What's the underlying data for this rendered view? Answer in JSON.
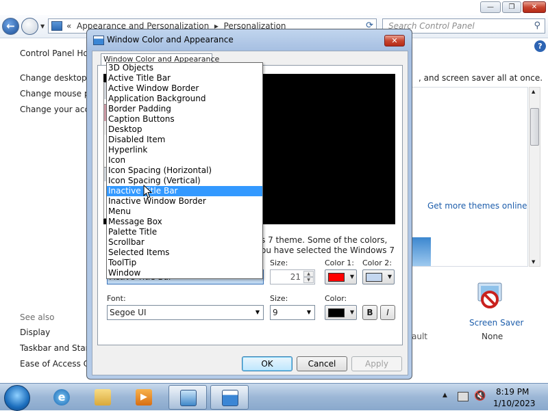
{
  "control_panel": {
    "breadcrumb": [
      "«",
      "Appearance and Personalization",
      "▸",
      "Personalization"
    ],
    "search_placeholder": "Search Control Panel",
    "sidebar": {
      "home": "Control Panel Hom",
      "links": [
        "Change desktop ic",
        "Change mouse po",
        "Change your acco"
      ],
      "see_also_heading": "See also",
      "see_also": [
        "Display",
        "Taskbar and Start M",
        "Ease of Access Cen"
      ]
    },
    "main_text": ", and screen saver all at once.",
    "get_more_themes": "Get more themes online",
    "screen_saver_label": "Screen Saver",
    "screen_saver_value": "None",
    "partial_text": "ault"
  },
  "dialog": {
    "title": "Window Color and Appearance",
    "tab": "Window Color and Appearance",
    "description_lines": [
      "s 7 theme.  Some of the colors,",
      "ou have selected the Windows 7"
    ],
    "size_label": "Size:",
    "size_value": "21",
    "color1_label": "Color 1:",
    "color2_label": "Color 2:",
    "item_value": "Active Title Bar",
    "font_label": "Font:",
    "font_value": "Segoe UI",
    "font_size_label": "Size:",
    "font_size_value": "9",
    "font_color_label": "Color:",
    "bold_label": "B",
    "italic_label": "I",
    "ok_label": "OK",
    "cancel_label": "Cancel",
    "apply_label": "Apply",
    "colors": {
      "color1": "#ff0000",
      "color2": "#c4d7f0",
      "font_color": "#000000"
    }
  },
  "item_list": {
    "selected_index": 12,
    "items": [
      "3D Objects",
      "Active Title Bar",
      "Active Window Border",
      "Application Background",
      "Border Padding",
      "Caption Buttons",
      "Desktop",
      "Disabled Item",
      "Hyperlink",
      "Icon",
      "Icon Spacing (Horizontal)",
      "Icon Spacing (Vertical)",
      "Inactive Title Bar",
      "Inactive Window Border",
      "Menu",
      "Message Box",
      "Palette Title",
      "Scrollbar",
      "Selected Items",
      "ToolTip",
      "Window"
    ]
  },
  "taskbar": {
    "apps": [
      "internet-explorer",
      "windows-explorer",
      "media-player",
      "control-panel",
      "window-color-dialog"
    ],
    "time": "8:19 PM",
    "date": "1/10/2023"
  }
}
